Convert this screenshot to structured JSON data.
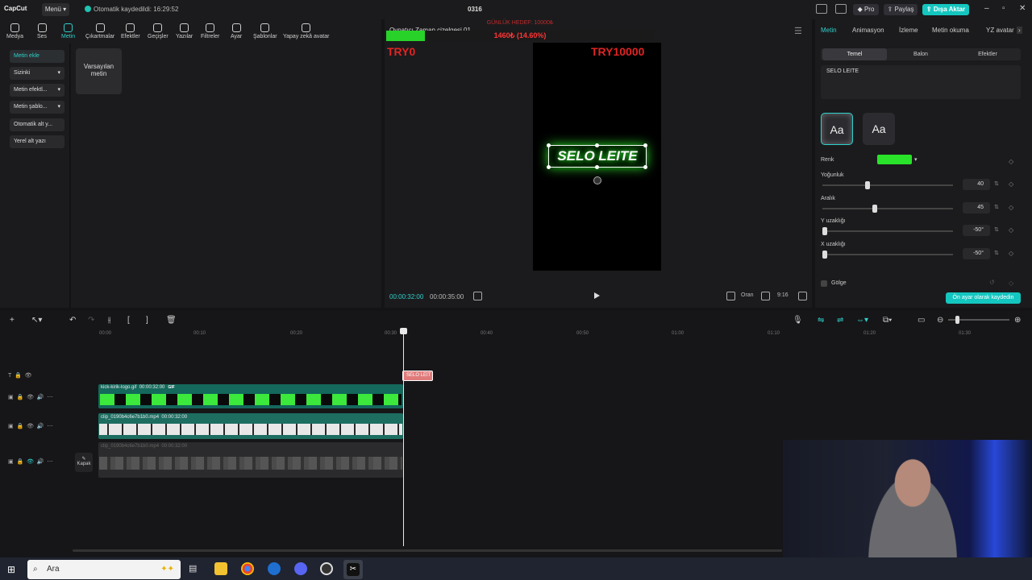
{
  "titlebar": {
    "logo": "CapCut",
    "menu": "Menü",
    "autosave": "Otomatik kaydedildi: 16:29:52",
    "project": "0316",
    "pro": "Pro",
    "share": "Paylaş",
    "export": "Dışa Aktar"
  },
  "toolbar": [
    {
      "label": "Medya",
      "icon": "media-icon"
    },
    {
      "label": "Ses",
      "icon": "audio-icon"
    },
    {
      "label": "Metin",
      "icon": "text-icon",
      "active": true
    },
    {
      "label": "Çıkartmalar",
      "icon": "sticker-icon"
    },
    {
      "label": "Efektler",
      "icon": "effects-icon"
    },
    {
      "label": "Geçişler",
      "icon": "transitions-icon"
    },
    {
      "label": "Yazılar",
      "icon": "captions-icon"
    },
    {
      "label": "Filtreler",
      "icon": "filters-icon"
    },
    {
      "label": "Ayar",
      "icon": "adjust-icon"
    },
    {
      "label": "Şablonlar",
      "icon": "templates-icon"
    },
    {
      "label": "Yapay zekâ avatar",
      "icon": "ai-avatar-icon"
    }
  ],
  "leftnav": [
    "Metin ekle",
    "Sizinki",
    "Metin efektl...",
    "Metin şablo...",
    "Otomatik alt y...",
    "Yerel alt yazı"
  ],
  "default_card": "Varsayılan metin",
  "player": {
    "title": "Oynatıcı Zaman çizelgesi 01",
    "goal_title": "GÜNLÜK HEDEF: 10000₺",
    "progress_text": "1460₺ (14.60%)",
    "progress": 0.146,
    "left_label": "TRY0",
    "right_label": "TRY10000",
    "overlay_text": "SELO LEITE",
    "current_time": "00:00:32:00",
    "total_time": "00:00:35:00",
    "ratio": "Oran",
    "aspect": "9:16"
  },
  "right": {
    "tabs": [
      "Metin",
      "Animasyon",
      "İzleme",
      "Metin okuma",
      "YZ avatar"
    ],
    "subtabs": [
      "Temel",
      "Balon",
      "Efektler"
    ],
    "text_value": "SELO LEITE",
    "style_preset": "Aa",
    "color_label": "Renk",
    "color": "#29e229",
    "sliders": [
      {
        "label": "Yoğunluk",
        "value": "40",
        "pos": 0.33
      },
      {
        "label": "Aralık",
        "value": "45",
        "pos": 0.38
      },
      {
        "label": "Y uzaklığı",
        "value": "-50°",
        "pos": 0
      },
      {
        "label": "X uzaklığı",
        "value": "-50°",
        "pos": 0
      }
    ],
    "shadow": "Gölge",
    "save_preset": "Ön ayar olarak kaydedin"
  },
  "ruler": [
    "00:00",
    "00:10",
    "00:20",
    "00:30",
    "00:40",
    "00:50",
    "01:00",
    "01:10",
    "01:20",
    "01:30"
  ],
  "tracks": {
    "text_clip": "SELO LEIT",
    "gif_clip": "kick-kirik-logo.gif",
    "gif_time": "00:00:32:00",
    "gif_badge": "GIF",
    "video1": "clip_0190b4c6e7b1b0.mp4",
    "video1_time": "00:00:32:00",
    "video2": "clip_0190b4c6e7b1b0.mp4",
    "video2_time": "00:00:32:00",
    "cover": "Kapak"
  },
  "taskbar": {
    "search": "Ara"
  }
}
